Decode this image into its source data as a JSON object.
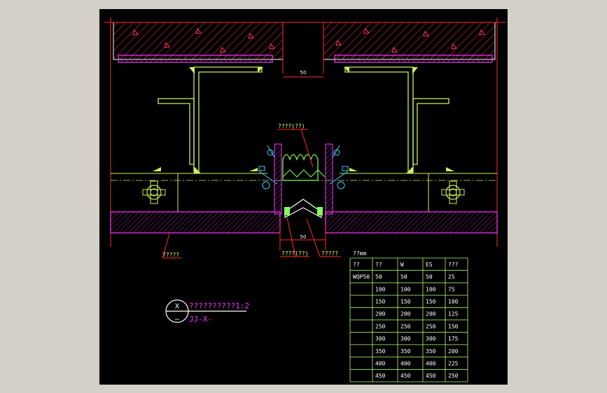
{
  "drawing": {
    "dim_top": "50",
    "dim_bottom": "50",
    "label_center_top": "????(??)",
    "label_left_bottom": "?????",
    "label_center_bottom_left": "????(??)",
    "label_center_bottom_right": "?????",
    "unit_label": "??mm",
    "title_symbol_top": "X",
    "title_symbol_bottom": "—",
    "title_main": "??????????1:2",
    "title_sub": "JJ-X-"
  },
  "table": {
    "headers": [
      "??",
      "??",
      "W",
      "ES",
      "???"
    ],
    "rows": [
      [
        "WQP50",
        "50",
        "50",
        "50",
        "25"
      ],
      [
        "",
        "100",
        "100",
        "100",
        "75"
      ],
      [
        "",
        "150",
        "150",
        "150",
        "100"
      ],
      [
        "",
        "200",
        "200",
        "200",
        "125"
      ],
      [
        "",
        "250",
        "250",
        "250",
        "150"
      ],
      [
        "",
        "300",
        "300",
        "300",
        "175"
      ],
      [
        "",
        "350",
        "350",
        "350",
        "200"
      ],
      [
        "",
        "400",
        "400",
        "400",
        "225"
      ],
      [
        "",
        "450",
        "450",
        "450",
        "250"
      ]
    ]
  },
  "colors": {
    "background": "#000000",
    "frame": "#d4d0c8",
    "red": "#ff2a2a",
    "magenta": "#ff33ff",
    "yellow_green": "#c8f060",
    "green": "#7fff55",
    "table_line": "#aaff77",
    "text_white": "#ffffff",
    "text_yellow": "#ffff66",
    "cyan": "#44ccff"
  }
}
